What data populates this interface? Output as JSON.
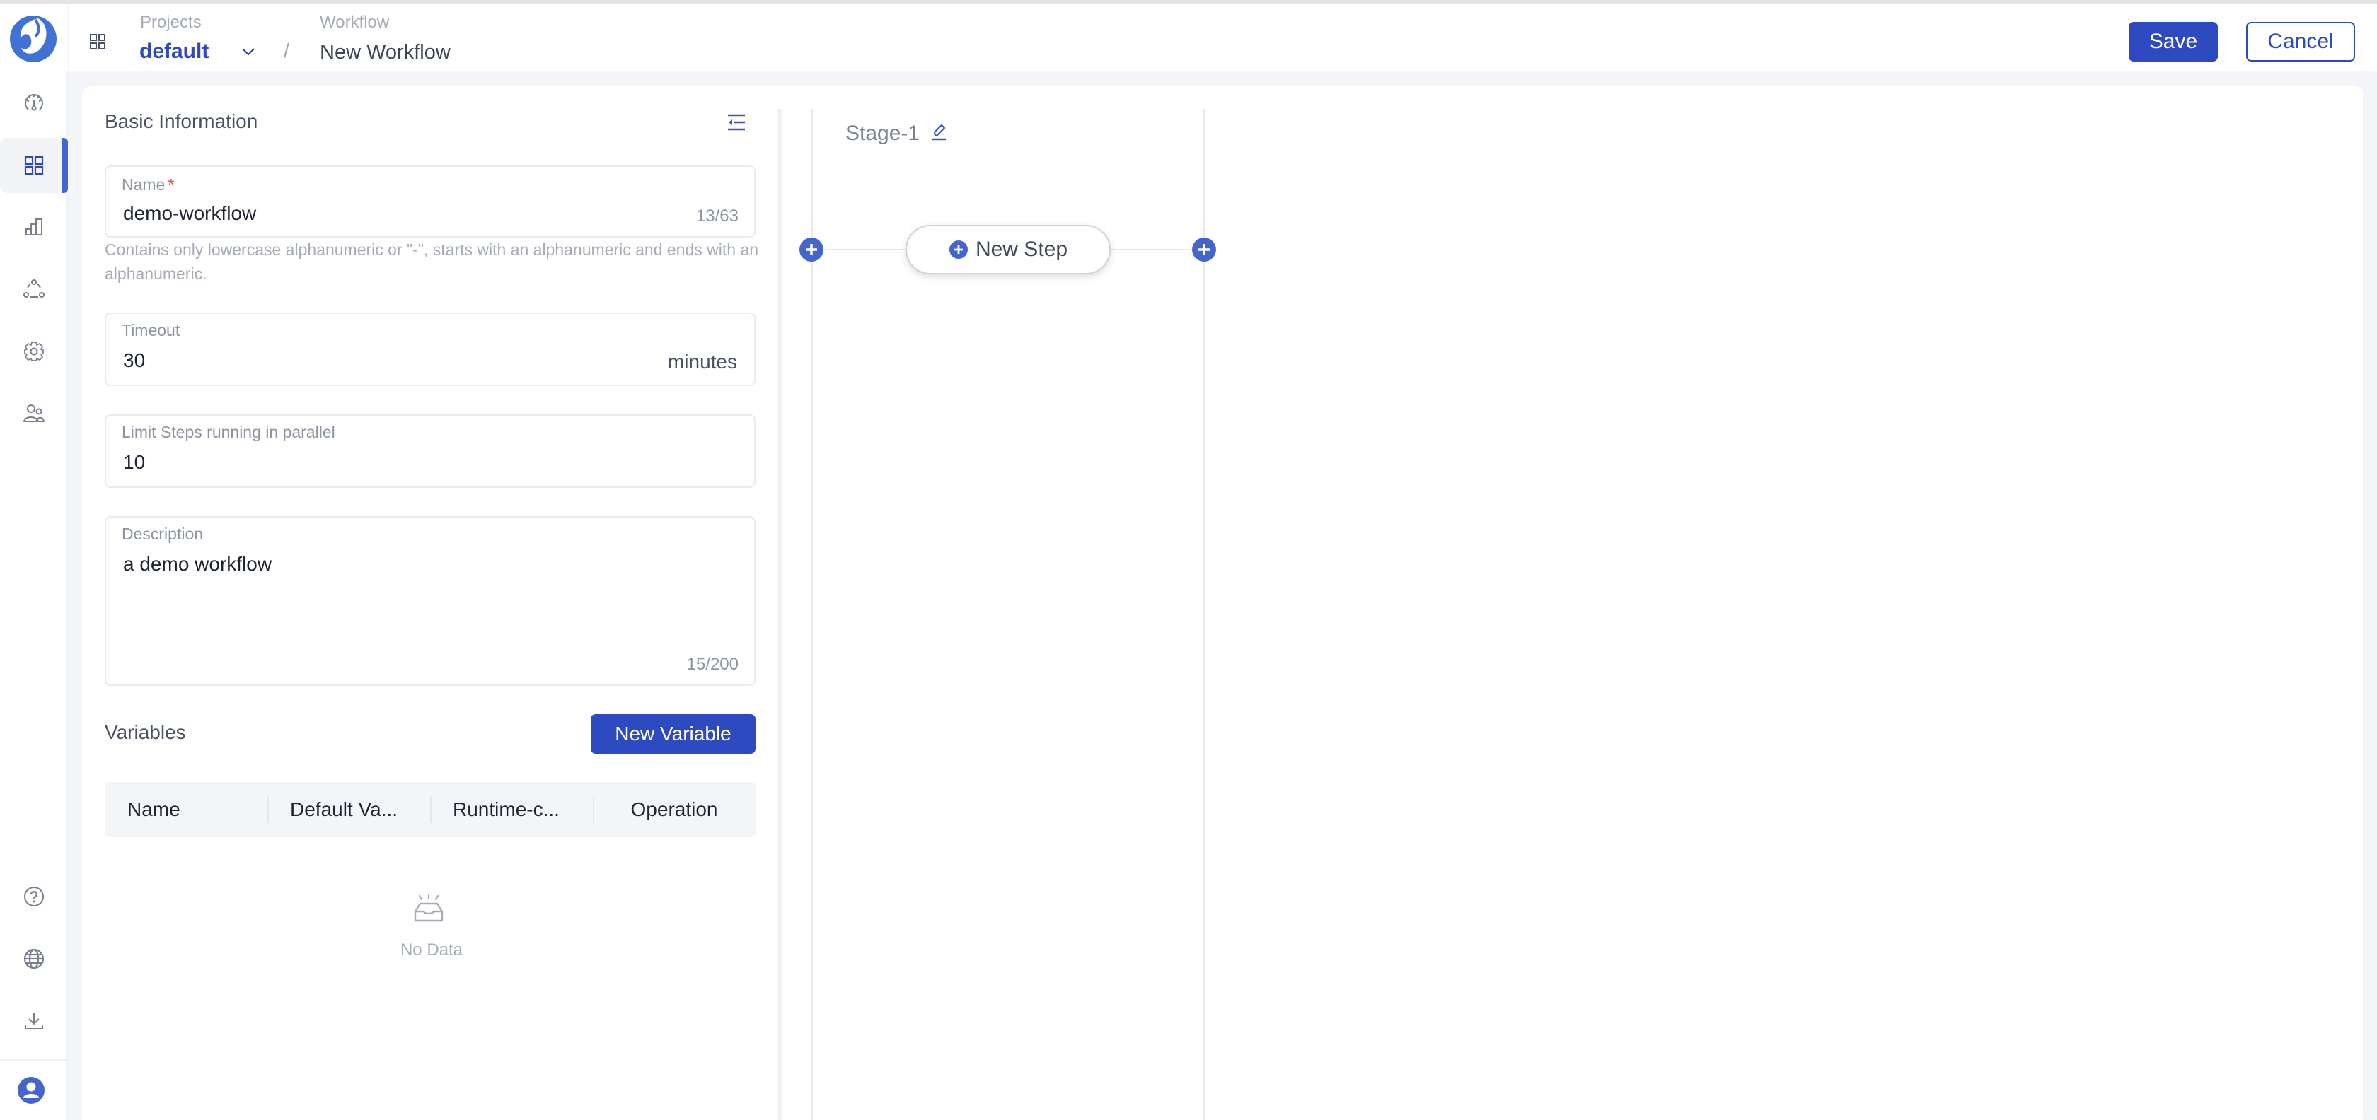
{
  "header": {
    "breadcrumb": {
      "projects_label": "Projects",
      "project_value": "default",
      "separator": "/",
      "workflow_label": "Workflow",
      "workflow_value": "New Workflow"
    },
    "actions": {
      "save_label": "Save",
      "cancel_label": "Cancel"
    }
  },
  "sidebar": {
    "items": [
      {
        "icon": "dashboard-gauge-icon",
        "active": false
      },
      {
        "icon": "apps-grid-icon",
        "active": true
      },
      {
        "icon": "bar-chart-icon",
        "active": false
      },
      {
        "icon": "cluster-nodes-icon",
        "active": false
      },
      {
        "icon": "gear-icon",
        "active": false
      },
      {
        "icon": "users-icon",
        "active": false
      }
    ],
    "bottom_items": [
      {
        "icon": "help-icon"
      },
      {
        "icon": "globe-icon"
      },
      {
        "icon": "download-icon"
      }
    ],
    "user_icon": "user-avatar-icon"
  },
  "form": {
    "basic_info_title": "Basic Information",
    "name": {
      "label": "Name",
      "required_mark": "*",
      "value": "demo-workflow",
      "count": "13/63",
      "hint": "Contains only lowercase alphanumeric or \"-\", starts with an alphanumeric and ends with an alphanumeric."
    },
    "timeout": {
      "label": "Timeout",
      "value": "30",
      "suffix": "minutes"
    },
    "parallel": {
      "label": "Limit Steps running in parallel",
      "value": "10"
    },
    "description": {
      "label": "Description",
      "value": "a demo workflow",
      "count": "15/200"
    },
    "variables": {
      "title": "Variables",
      "new_button": "New Variable",
      "columns": [
        "Name",
        "Default Va...",
        "Runtime-c...",
        "Operation"
      ],
      "rows": [],
      "empty_text": "No Data"
    }
  },
  "canvas": {
    "stages": [
      {
        "title": "Stage-1",
        "new_step_label": "New Step"
      }
    ],
    "colors": {
      "accent": "#4466cc",
      "primary": "#2e4ac0"
    }
  }
}
